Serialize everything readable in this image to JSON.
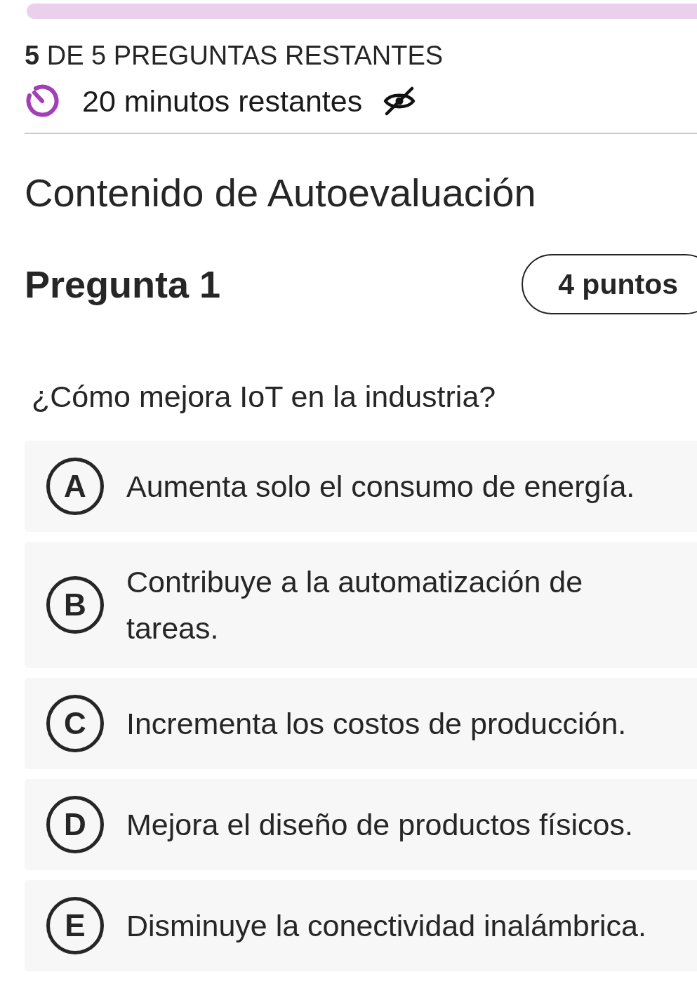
{
  "progress_bar": {
    "level": 0
  },
  "status": {
    "remaining": "**5** DE 5 PREGUNTAS RESTANTES",
    "timer": "20 minutos restantes"
  },
  "title": "Contenido de Autoevaluación",
  "question": {
    "heading": "Pregunta 1",
    "points": "4 puntos",
    "prompt": "¿Cómo mejora IoT en la industria?",
    "options": [
      {
        "letter": "A",
        "text": "Aumenta solo el consumo de energía.",
        "selected": false
      },
      {
        "letter": "B",
        "text": "Contribuye a la automatización de tareas.",
        "selected": false
      },
      {
        "letter": "C",
        "text": "Incrementa los costos de producción.",
        "selected": false
      },
      {
        "letter": "D",
        "text": "Mejora el diseño de productos físicos.",
        "selected": false
      },
      {
        "letter": "E",
        "text": "Disminuye la conectividad inalámbrica.",
        "selected": false
      }
    ]
  }
}
